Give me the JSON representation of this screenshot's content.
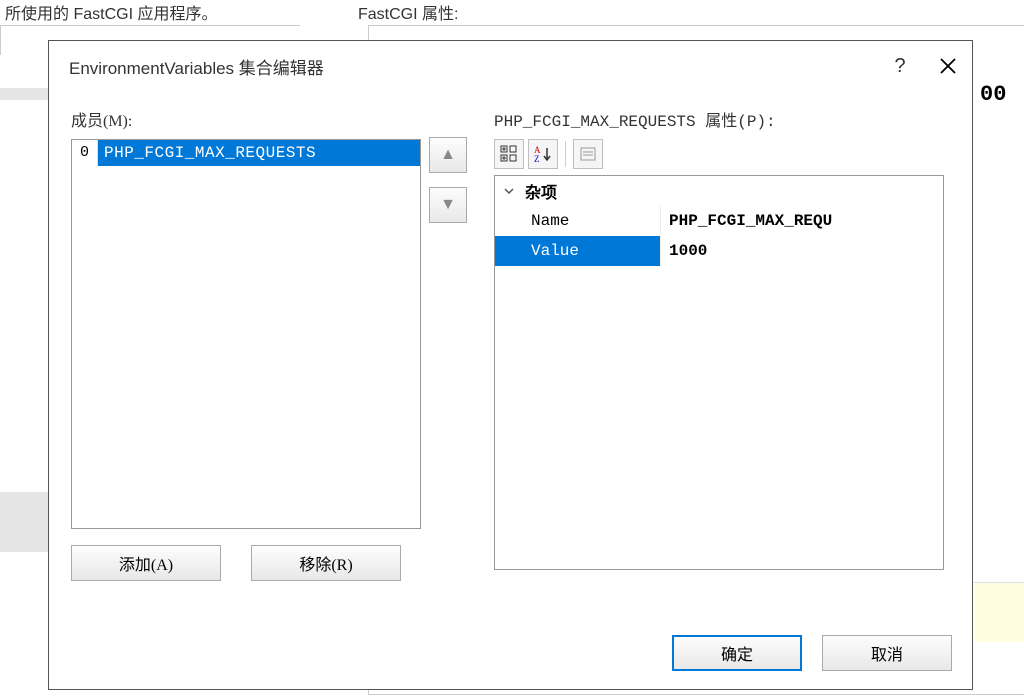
{
  "background": {
    "text_left": "所使用的 FastCGI 应用程序。",
    "text_right": "FastCGI 属性:",
    "partial_value": "00"
  },
  "dialog": {
    "title": "EnvironmentVariables 集合编辑器",
    "help_symbol": "?",
    "left": {
      "label": "成员(M):",
      "items": [
        {
          "index": "0",
          "name": "PHP_FCGI_MAX_REQUESTS"
        }
      ],
      "add_button": "添加(A)",
      "remove_button": "移除(R)"
    },
    "right": {
      "label": "PHP_FCGI_MAX_REQUESTS 属性(P):",
      "category": "杂项",
      "rows": [
        {
          "name": "Name",
          "value": "PHP_FCGI_MAX_REQU"
        },
        {
          "name": "Value",
          "value": "1000"
        }
      ]
    },
    "footer": {
      "ok": "确定",
      "cancel": "取消"
    }
  }
}
